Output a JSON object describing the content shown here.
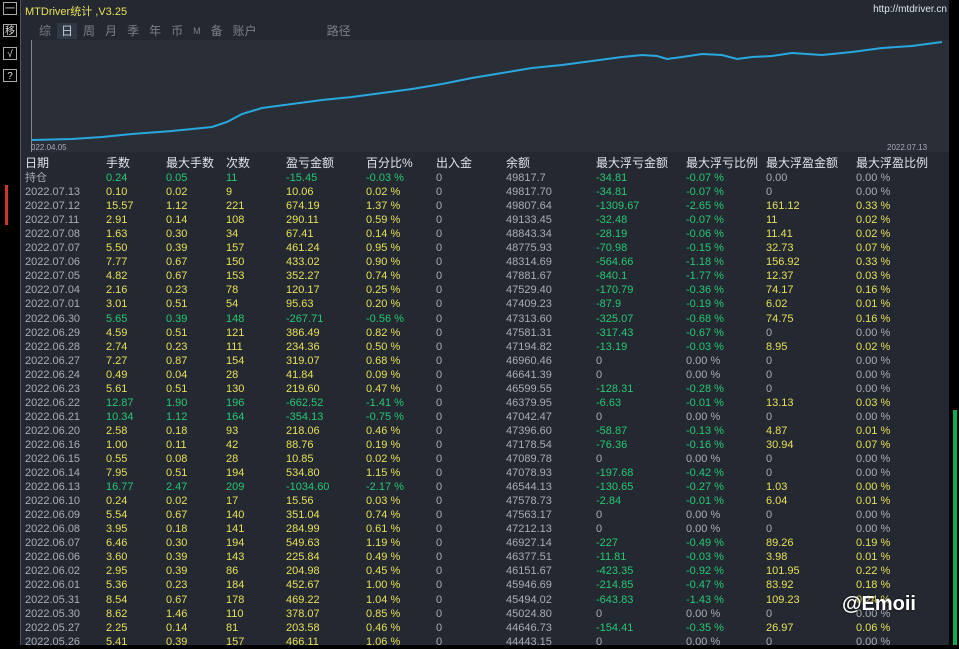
{
  "toolbar": {
    "items": [
      "一",
      "移",
      "√",
      "?"
    ]
  },
  "app": {
    "title": "MTDriver统计 ,V3.25",
    "url": "http://mtdriver.cn"
  },
  "tabs": [
    {
      "label": "综"
    },
    {
      "label": "日",
      "active": true
    },
    {
      "label": "周"
    },
    {
      "label": "月"
    },
    {
      "label": "季"
    },
    {
      "label": "年"
    },
    {
      "label": "币"
    },
    {
      "label": "M"
    },
    {
      "label": "备"
    },
    {
      "label": "账户"
    },
    {
      "label": "路径"
    }
  ],
  "chart": {
    "start_label": "022.04.05",
    "end_label": "2022.07.13",
    "line_color": "#29a8e0"
  },
  "columns": [
    "日期",
    "手数",
    "最大手数",
    "次数",
    "盈亏金额",
    "百分比%",
    "出入金",
    "余额",
    "最大浮亏金额",
    "最大浮亏比例",
    "最大浮盈金额",
    "最大浮盈比例"
  ],
  "rows": [
    [
      "持仓",
      "0.24",
      "0.05",
      "11",
      "-15.45",
      "-0.03 %",
      "0",
      "49817.7",
      "-34.81",
      "-0.07 %",
      "0.00",
      "0.00 %"
    ],
    [
      "2022.07.13",
      "0.10",
      "0.02",
      "9",
      "10.06",
      "0.02 %",
      "0",
      "49817.70",
      "-34.81",
      "-0.07 %",
      "0",
      "0.00 %"
    ],
    [
      "2022.07.12",
      "15.57",
      "1.12",
      "221",
      "674.19",
      "1.37 %",
      "0",
      "49807.64",
      "-1309.67",
      "-2.65 %",
      "161.12",
      "0.33 %"
    ],
    [
      "2022.07.11",
      "2.91",
      "0.14",
      "108",
      "290.11",
      "0.59 %",
      "0",
      "49133.45",
      "-32.48",
      "-0.07 %",
      "11",
      "0.02 %"
    ],
    [
      "2022.07.08",
      "1.63",
      "0.30",
      "34",
      "67.41",
      "0.14 %",
      "0",
      "48843.34",
      "-28.19",
      "-0.06 %",
      "11.41",
      "0.02 %"
    ],
    [
      "2022.07.07",
      "5.50",
      "0.39",
      "157",
      "461.24",
      "0.95 %",
      "0",
      "48775.93",
      "-70.98",
      "-0.15 %",
      "32.73",
      "0.07 %"
    ],
    [
      "2022.07.06",
      "7.77",
      "0.67",
      "150",
      "433.02",
      "0.90 %",
      "0",
      "48314.69",
      "-564.66",
      "-1.18 %",
      "156.92",
      "0.33 %"
    ],
    [
      "2022.07.05",
      "4.82",
      "0.67",
      "153",
      "352.27",
      "0.74 %",
      "0",
      "47881.67",
      "-840.1",
      "-1.77 %",
      "12.37",
      "0.03 %"
    ],
    [
      "2022.07.04",
      "2.16",
      "0.23",
      "78",
      "120.17",
      "0.25 %",
      "0",
      "47529.40",
      "-170.79",
      "-0.36 %",
      "74.17",
      "0.16 %"
    ],
    [
      "2022.07.01",
      "3.01",
      "0.51",
      "54",
      "95.63",
      "0.20 %",
      "0",
      "47409.23",
      "-87.9",
      "-0.19 %",
      "6.02",
      "0.01 %"
    ],
    [
      "2022.06.30",
      "5.65",
      "0.39",
      "148",
      "-267.71",
      "-0.56 %",
      "0",
      "47313.60",
      "-325.07",
      "-0.68 %",
      "74.75",
      "0.16 %"
    ],
    [
      "2022.06.29",
      "4.59",
      "0.51",
      "121",
      "386.49",
      "0.82 %",
      "0",
      "47581.31",
      "-317.43",
      "-0.67 %",
      "0",
      "0.00 %"
    ],
    [
      "2022.06.28",
      "2.74",
      "0.23",
      "111",
      "234.36",
      "0.50 %",
      "0",
      "47194.82",
      "-13.19",
      "-0.03 %",
      "8.95",
      "0.02 %"
    ],
    [
      "2022.06.27",
      "7.27",
      "0.87",
      "154",
      "319.07",
      "0.68 %",
      "0",
      "46960.46",
      "0",
      "0.00 %",
      "0",
      "0.00 %"
    ],
    [
      "2022.06.24",
      "0.49",
      "0.04",
      "28",
      "41.84",
      "0.09 %",
      "0",
      "46641.39",
      "0",
      "0.00 %",
      "0",
      "0.00 %"
    ],
    [
      "2022.06.23",
      "5.61",
      "0.51",
      "130",
      "219.60",
      "0.47 %",
      "0",
      "46599.55",
      "-128.31",
      "-0.28 %",
      "0",
      "0.00 %"
    ],
    [
      "2022.06.22",
      "12.87",
      "1.90",
      "196",
      "-662.52",
      "-1.41 %",
      "0",
      "46379.95",
      "-6.63",
      "-0.01 %",
      "13.13",
      "0.03 %"
    ],
    [
      "2022.06.21",
      "10.34",
      "1.12",
      "164",
      "-354.13",
      "-0.75 %",
      "0",
      "47042.47",
      "0",
      "0.00 %",
      "0",
      "0.00 %"
    ],
    [
      "2022.06.20",
      "2.58",
      "0.18",
      "93",
      "218.06",
      "0.46 %",
      "0",
      "47396.60",
      "-58.87",
      "-0.13 %",
      "4.87",
      "0.01 %"
    ],
    [
      "2022.06.16",
      "1.00",
      "0.11",
      "42",
      "88.76",
      "0.19 %",
      "0",
      "47178.54",
      "-76.36",
      "-0.16 %",
      "30.94",
      "0.07 %"
    ],
    [
      "2022.06.15",
      "0.55",
      "0.08",
      "28",
      "10.85",
      "0.02 %",
      "0",
      "47089.78",
      "0",
      "0.00 %",
      "0",
      "0.00 %"
    ],
    [
      "2022.06.14",
      "7.95",
      "0.51",
      "194",
      "534.80",
      "1.15 %",
      "0",
      "47078.93",
      "-197.68",
      "-0.42 %",
      "0",
      "0.00 %"
    ],
    [
      "2022.06.13",
      "16.77",
      "2.47",
      "209",
      "-1034.60",
      "-2.17 %",
      "0",
      "46544.13",
      "-130.65",
      "-0.27 %",
      "1.03",
      "0.00 %"
    ],
    [
      "2022.06.10",
      "0.24",
      "0.02",
      "17",
      "15.56",
      "0.03 %",
      "0",
      "47578.73",
      "-2.84",
      "-0.01 %",
      "6.04",
      "0.01 %"
    ],
    [
      "2022.06.09",
      "5.54",
      "0.67",
      "140",
      "351.04",
      "0.74 %",
      "0",
      "47563.17",
      "0",
      "0.00 %",
      "0",
      "0.00 %"
    ],
    [
      "2022.06.08",
      "3.95",
      "0.18",
      "141",
      "284.99",
      "0.61 %",
      "0",
      "47212.13",
      "0",
      "0.00 %",
      "0",
      "0.00 %"
    ],
    [
      "2022.06.07",
      "6.46",
      "0.30",
      "194",
      "549.63",
      "1.19 %",
      "0",
      "46927.14",
      "-227",
      "-0.49 %",
      "89.26",
      "0.19 %"
    ],
    [
      "2022.06.06",
      "3.60",
      "0.39",
      "143",
      "225.84",
      "0.49 %",
      "0",
      "46377.51",
      "-11.81",
      "-0.03 %",
      "3.98",
      "0.01 %"
    ],
    [
      "2022.06.02",
      "2.95",
      "0.39",
      "86",
      "204.98",
      "0.45 %",
      "0",
      "46151.67",
      "-423.35",
      "-0.92 %",
      "101.95",
      "0.22 %"
    ],
    [
      "2022.06.01",
      "5.36",
      "0.23",
      "184",
      "452.67",
      "1.00 %",
      "0",
      "45946.69",
      "-214.85",
      "-0.47 %",
      "83.92",
      "0.18 %"
    ],
    [
      "2022.05.31",
      "8.54",
      "0.67",
      "178",
      "469.22",
      "1.04 %",
      "0",
      "45494.02",
      "-643.83",
      "-1.43 %",
      "109.23",
      "0.24 %"
    ],
    [
      "2022.05.30",
      "8.62",
      "1.46",
      "110",
      "378.07",
      "0.85 %",
      "0",
      "45024.80",
      "0",
      "0.00 %",
      "0",
      "0.00 %"
    ],
    [
      "2022.05.27",
      "2.25",
      "0.14",
      "81",
      "203.58",
      "0.46 %",
      "0",
      "44646.73",
      "-154.41",
      "-0.35 %",
      "26.97",
      "0.06 %"
    ],
    [
      "2022.05.26",
      "5.41",
      "0.39",
      "157",
      "466.11",
      "1.06 %",
      "0",
      "44443.15",
      "0",
      "0.00 %",
      "0",
      "0.00 %"
    ]
  ],
  "watermark": "@Emoii",
  "colors": {
    "positive": "#e6e05a",
    "negative": "#27c774",
    "neutral": "#a8adb6"
  }
}
